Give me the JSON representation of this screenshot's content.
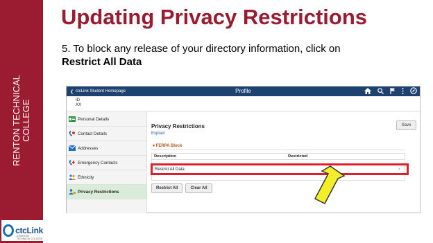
{
  "slide": {
    "title": "Updating Privacy Restrictions",
    "step_text": "5. To block any release of your directory information, click on",
    "step_bold": "Restrict All Data",
    "college_name_line1": "RENTON TECHNICAL",
    "college_name_line2": "COLLEGE",
    "logo_text": "ctcLink",
    "logo_subtext": "A RENTON TECHNICAL COLLEGE",
    "colors": {
      "brand": "#9b1b30",
      "topbar": "#1d4270",
      "highlight": "#e01e2b",
      "arrow": "#f4ee2a"
    }
  },
  "app": {
    "back_label": "ctcLink Student Homepage",
    "page_title": "Profile",
    "icons": [
      "home-icon",
      "search-icon",
      "flag-icon",
      "more-icon",
      "navbar-icon"
    ],
    "id_label": "ID",
    "id_value": "XX",
    "sidebar": {
      "items": [
        {
          "label": "Personal Details",
          "icon": "id-card-icon"
        },
        {
          "label": "Contact Details",
          "icon": "phone-icon"
        },
        {
          "label": "Addresses",
          "icon": "envelope-icon"
        },
        {
          "label": "Emergency Contacts",
          "icon": "emergency-phone-icon"
        },
        {
          "label": "Ethnicity",
          "icon": "people-icon"
        },
        {
          "label": "Privacy Restrictions",
          "icon": "person-lock-icon",
          "active": true
        }
      ]
    },
    "main": {
      "title": "Privacy Restrictions",
      "explain_link": "Explain",
      "save_label": "Save",
      "section_title": "FERPA Block",
      "table": {
        "headers": [
          "Description",
          "Restricted"
        ],
        "rows": [
          {
            "description": "Restrict All Data",
            "restricted": ""
          }
        ]
      },
      "restrict_all_label": "Restrict All",
      "clear_all_label": "Clear All"
    }
  }
}
